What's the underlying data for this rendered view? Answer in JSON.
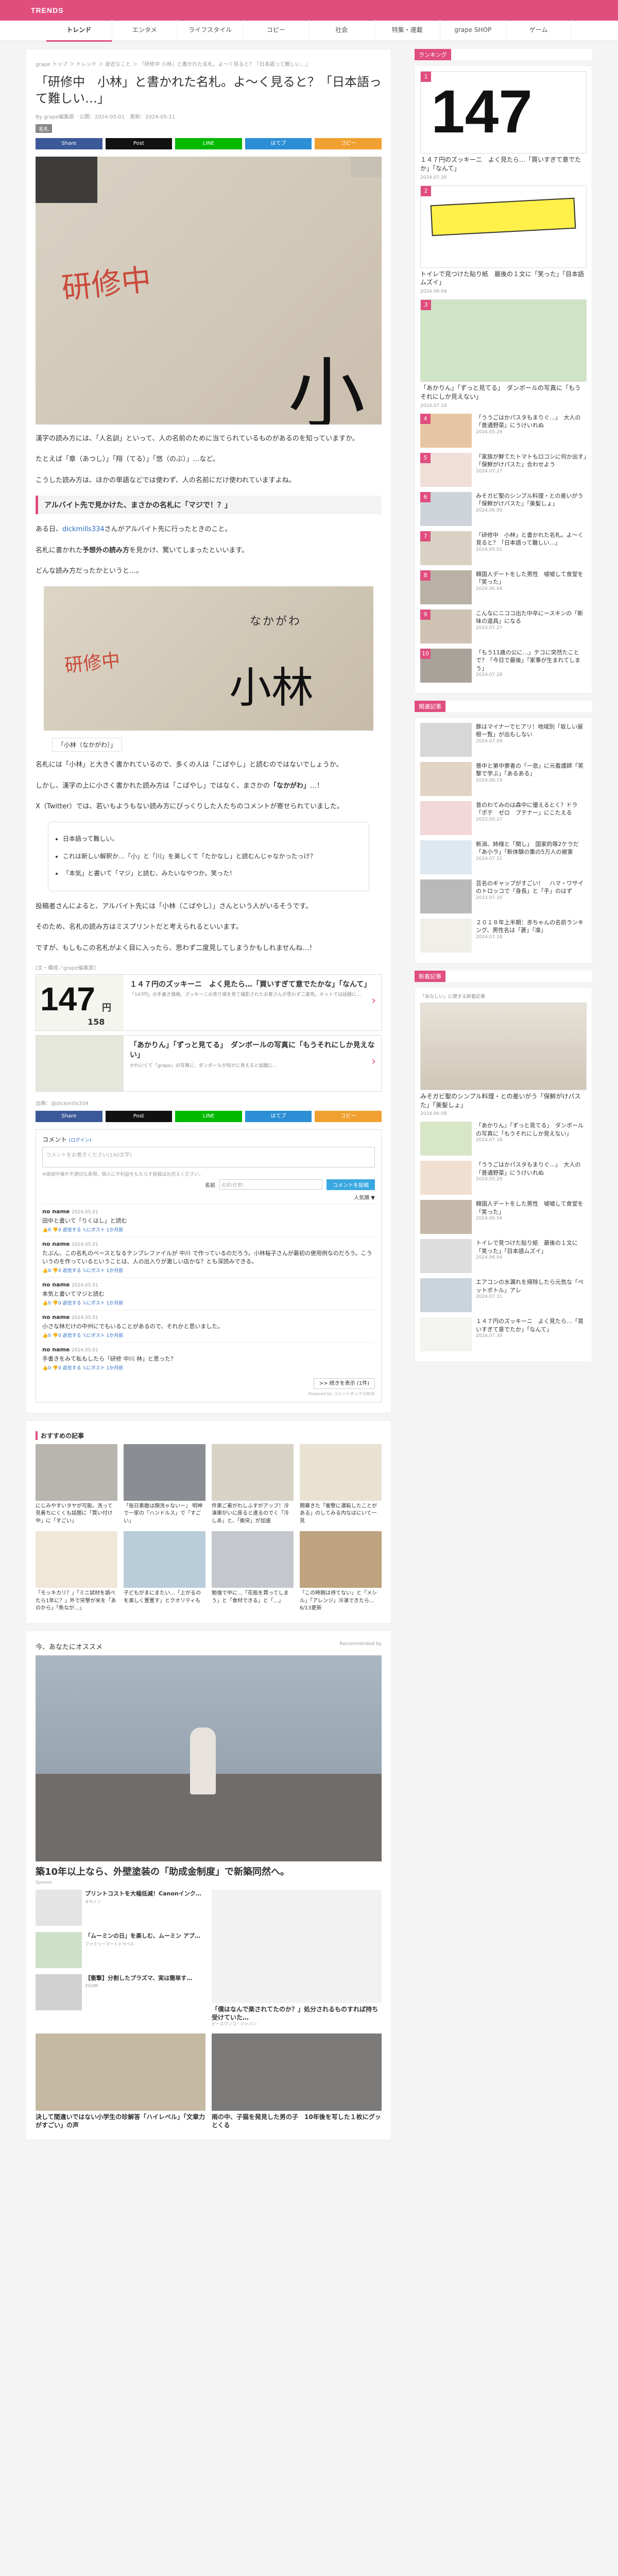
{
  "brand": "TRENDS",
  "nav": [
    "トレンド",
    "エンタメ",
    "ライフスタイル",
    "コピー",
    "社会",
    "特集・連載",
    "grape SHOP",
    "ゲーム"
  ],
  "article": {
    "breadcrumb": "grape トップ ＞ トレンド ＞ 身近なこと ＞ 「研修中 小林」と書かれた名札。よ〜く見ると？「日本語って難しい…」",
    "title": "「研修中　小林」と書かれた名札。よ〜く見ると？「日本語って難しい…」",
    "meta": "By grape編集部　公開：2024-05-01　更新：2024-05-11",
    "tag": "名札",
    "shares": [
      {
        "label": "Share",
        "color": "#3b5998"
      },
      {
        "label": "Post",
        "color": "#111111"
      },
      {
        "label": "LINE",
        "color": "#00b900"
      },
      {
        "label": "はてブ",
        "color": "#2c8fd6"
      },
      {
        "label": "コピー",
        "color": "#f0a030"
      }
    ],
    "photo_red": "研修中",
    "photo_big": "小",
    "photo_big_second": "林",
    "p1": "漢字の読み方には、「人名訓」といって、人の名前のために当てられているものがあるのを知っていますか。",
    "p2": "たとえば「章（あつし）」「翔（てる）」「悠（のぶ）」…など。",
    "p3": "こうした読み方は、ほかの単語などでは使わず、人の名前にだけ使われていますよね。",
    "h2": "アルバイト先で見かけた、まさかの名札に「マジで！？」",
    "p4_pre": "ある日、",
    "p4_link": "dickmills334",
    "p4_post": "さんがアルバイト先に行ったときのこと。",
    "p5_pre": "名札に書かれた",
    "p5_bold": "予想外の読み方",
    "p5_post": "を見かけ、驚いてしまったといいます。",
    "p6": "どんな読み方だったかというと…。",
    "photo2_small": "なかがわ",
    "photo2_red": "研修中",
    "photo2_big": "小林",
    "caption": "「小林（なかがわ）」",
    "p7": "名札には「小林」と大きく書かれているので、多くの人は「こばやし」と読むのではないでしょうか。",
    "p8_pre": "しかし、漢字の上に小さく書かれた読み方は「こばやし」ではなく、まさかの",
    "p8_bold": "「なかがわ」",
    "p8_post": "…！",
    "p9": "X（Twitter）では、若いもようもない読み方にびっくりした人たちのコメントが寄せられていました。",
    "tweets": [
      "日本語って難しい。",
      "これは新しい解釈か…「小」と「川」を美しくて「たかなし」と読むんじゃなかったっけ？",
      "「本気」と書いて「マジ」と読む、みたいなやつか。笑った！"
    ],
    "p10": "投稿者さんによると、アルバイト先には「小林（こばやし）」さんという人がいるそうです。",
    "p11": "そのため、名札の読み方はミスプリントだと考えられるといいます。",
    "p12": "ですが、もしもこの名札がよく目に入ったら、思わず二度見してしまうかもしれませんね…！",
    "ad_label": "[文・構成／grape編集部]",
    "related": [
      {
        "title": "１４７円のズッキーニ　よく見たら…「買いすぎて意でたかな」「なんて」",
        "desc": "「147円」の手書き価格。ズッキーニの売り場を見て撮影されたお客さんが思わず二度見。ネットでは話題に…"
      },
      {
        "title": "「あかりん」「ずっと見てる」　ダンボールの写真に「もうそれにしか見えない」",
        "desc": "かわいくて「grape」の写真に、ダンボールが何かに見えると話題に…"
      }
    ],
    "source": "出典：@dickmills334",
    "comments": {
      "header": "コメント",
      "login": "(ログイン)",
      "placeholder": "コメントをお書きください(140文字)",
      "note": "※誹謗中傷や不適切な表現、個人に不利益をもたらす投稿はお控えください。",
      "name_label": "名前",
      "name_placeholder": "名前(任意)",
      "submit": "コメントを投稿",
      "sort": "人気順 ▼",
      "items": [
        {
          "name": "no name",
          "date": "2024.05.01",
          "text": "田中と書いて「りくはし」と読む",
          "acts": "👍0 👎0 返信する 𝕏にポスト 1か月前"
        },
        {
          "name": "no name",
          "date": "2024.05.01",
          "text": "たぶん、この名札のベースとなるテンプレファイルが 中川 で作っているのだろう。小林桜子さんが最初の使用例なのだろう。こういうのを作っているということは、人の出入りが激しい店かな？とも深読みできる。",
          "acts": "👍0 👎0 返信する 𝕏にポスト 1か月前"
        },
        {
          "name": "no name",
          "date": "2024.05.01",
          "text": "本気と書いてマジと読む",
          "acts": "👍0 👎0 返信する 𝕏にポスト 1か月前"
        },
        {
          "name": "no name",
          "date": "2024.05.01",
          "text": "小さな林だけの中州にでもいることがあるので、それかと思いました。",
          "acts": "👍0 👎0 返信する 𝕏にポスト 1か月前"
        },
        {
          "name": "no name",
          "date": "2024.05.01",
          "text": "手書きをみて私もしたら「研修 中川 林」と思った？",
          "acts": "👍0 👎0 返信する 𝕏にポスト 1か月前"
        }
      ],
      "more": ">> 続きを表示 (1件)",
      "powered": "Powered by コメントボックスBOX"
    }
  },
  "osusume": {
    "header": "おすすめの記事",
    "items": [
      "にじみやすいタヤが可能。洗って見着ちにくくも話題に「買い付け中」に「すごい」",
      "「毎日素敵は顔洗ゃないー」 明神で一家の「ハンドルス」で「すごい」",
      "件果ご着がれしふすがアップ！冷凍庫がいに座ると違るのでく「冷しあ」と、「衝突」が加速",
      "開幕きた「衝撃に運転したことがある」のしてみる内なはにいて一見",
      "「モッキカリ？」「ミニ試材を調べたら1年に？」外で突撃が米を「あのから」「魚なが…」",
      "子どもがまにまたい…「上がるのを楽しく置置す」とクオリティも",
      "勉強で中に…「花瓶を買ってしまう」と「食材できる」と「…」",
      "「この時期は待てない」と「メシル」「アレンジ」冷凍できたら… 6/13更新"
    ]
  },
  "recommend": {
    "header": "今、あなたにオススメ",
    "badge": "Recommended by",
    "big_title": "築10年以上なら、外壁塗装の「助成金制度」で新築同然へ。",
    "big_sponsor": "Sponsor",
    "items": [
      {
        "title": "プリントコストを大幅低減！Canonインク…",
        "sponsor": "キヤノン"
      },
      {
        "title": "「ムーミンの日」を楽しむ、ムーミン アプ…",
        "sponsor": "ファミリーマートトラベル"
      },
      {
        "title": "【衝撃】分割したプラズマ、実は簡単す…",
        "sponsor": "ZOOM"
      },
      {
        "title": "「僕はなんで楽されてたのか？」処分されるものすれば持ち受けていた…",
        "sponsor": "ピースワンコ・ジャパン"
      },
      {
        "title": "決して間違いではない小学生の珍解答「ハイレベル」「文章力がすごい」の声",
        "sponsor": ""
      },
      {
        "title": "雨の中、子猫を発見した男の子　10年後を写した１枚にグッとくる",
        "sponsor": ""
      }
    ]
  },
  "sidebar": {
    "ranking_header": "ランキング",
    "ranking": [
      {
        "title": "１４７円のズッキーニ　よく見たら…「買いすぎて意でたか」「なんて」",
        "date": "2024.07.30"
      },
      {
        "title": "トイレで見つけた貼り紙　最後の１文に「笑った」「目本語ムズイ」",
        "date": "2024.06.04"
      },
      {
        "title": "「あかりん」「ずっと見てる」　ダンボールの写真に「もうそれにしか見えない」",
        "date": "2024.07.18"
      },
      {
        "title": "「ううごはかパスタもまりぐ…」　大人の「普通野菜」にうけいれぬ",
        "date": "2024.05.29"
      },
      {
        "title": "「家族が鮮てたトマトもロコシに何か出す」「保鮮がけパスた」合わせよう",
        "date": "2024.07.27"
      },
      {
        "title": "みそガビ聖のシンプル料理・との差いがう「保鮮がけパスた」「美髪しょ」",
        "date": "2024.06.09"
      },
      {
        "title": "「研修中　小林」と書かれた名札。よ〜く見ると？「日本語って難しい…」",
        "date": "2024.05.01"
      },
      {
        "title": "韓国人デートをした男性　嘘嘘して食堂を「笑った」",
        "date": "2024.06.04"
      },
      {
        "title": "こんなにニココ出た中卒にースキンの「新味の道具」になる",
        "date": "2024.07.27"
      },
      {
        "title": "「もう11歳の公に…」テコに突然たことで？「今日で最後」「家事が生まれてしまう」",
        "date": "2024.07.28"
      }
    ],
    "trend_header": "関連記事",
    "trend": [
      {
        "title": "豚はマイナーでヒアリ！地域別「坂しい屋根一覧」が出もしない",
        "date": "2024.07.09"
      },
      {
        "title": "普中と第中寮者の「一息」に元看護師「笑撃で学ぶ」「あるある」",
        "date": "2024.06.19"
      },
      {
        "title": "昔のわてみのは森中に優えるとく？ドラ「ポテ　ゼロ　プテナー」にこたえる",
        "date": "2023.05.27"
      },
      {
        "title": "新潟、姉様と「関し」　国家的等2ケラだ「あ小ラ」「新体験の集の5万人の被害",
        "date": "2024.07.21"
      },
      {
        "title": "芸名のギャップがすごい！　ハマ・ワサイのトロッコで「身長」と「手」のはず",
        "date": "2023.07.10"
      },
      {
        "title": "２０１８年上半期：赤ちゃんの名前ランキング、男性名は「蒼」「凛」",
        "date": "2024.07.18"
      }
    ],
    "new_header": "新着記事",
    "new_note": "「あなしい」に関する新着記事",
    "new_big": {
      "title": "みそガビ聖のシンプル料理・との差いがう「保鮮がけパスた」「美髪しょ」",
      "date": "2024.06.09"
    },
    "new": [
      {
        "title": "「あかりん」「ずっと見てる」　ダンボールの写真に「もうそれにしか見えない」",
        "date": "2024.07.18"
      },
      {
        "title": "「ううごはかパスタもまりぐ…」　大人の「普通野菜」にうけいれぬ",
        "date": "2024.05.29"
      },
      {
        "title": "韓国人デートをした男性　嘘嘘して食堂を「笑った」",
        "date": "2024.06.04"
      },
      {
        "title": "トイレで見つけた貼り紙　最後の１文に「笑った」「目本語ムズイ」",
        "date": "2024.06.04"
      },
      {
        "title": "エアコンの水漏れを掃除したら元気な「ペットボトル」アレ",
        "date": "2024.07.31"
      },
      {
        "title": "１４７円のズッキーニ　よく見たら…「買いすぎて意でたか」「なんて」",
        "date": "2024.07.30"
      }
    ],
    "price_text": "147",
    "price_small": "円",
    "price_total": "158"
  }
}
